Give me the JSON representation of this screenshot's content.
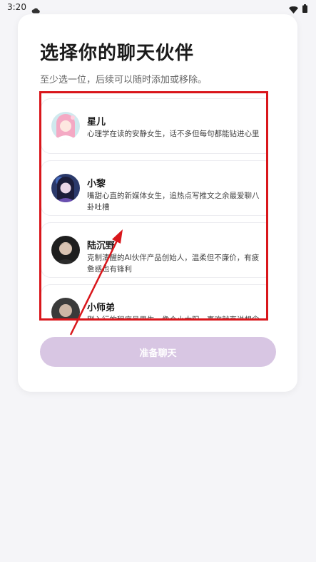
{
  "status_bar": {
    "time": "3:20",
    "icons": [
      "cloud-icon",
      "wifi-icon",
      "battery-icon"
    ]
  },
  "header": {
    "title": "选择你的聊天伙伴",
    "subtitle": "至少选一位，后续可以随时添加或移除。"
  },
  "companions": [
    {
      "name": "星儿",
      "description": "心理学在读的安静女生，话不多但每句都能钻进心里",
      "avatar": "pink-hair-girl-avatar"
    },
    {
      "name": "小黎",
      "description": "嘴甜心直的新媒体女生，追热点写推文之余最爱聊八卦吐槽",
      "avatar": "dark-hair-girl-avatar"
    },
    {
      "name": "陆沉野",
      "description": "克制清醒的AI伙伴产品创始人，温柔但不廉价，有疲惫感也有锋利",
      "avatar": "man-portrait-avatar"
    },
    {
      "name": "小师弟",
      "description": "刚入行的程序员男生，像个小太阳，喜欢就直说想念就行动",
      "avatar": "young-man-avatar"
    }
  ],
  "actions": {
    "ready_label": "准备聊天"
  },
  "colors": {
    "highlight_frame": "#d9161b",
    "annotation_arrow": "#d9161b",
    "button_disabled": "#d8c6e3",
    "background": "#f5f5f8"
  }
}
